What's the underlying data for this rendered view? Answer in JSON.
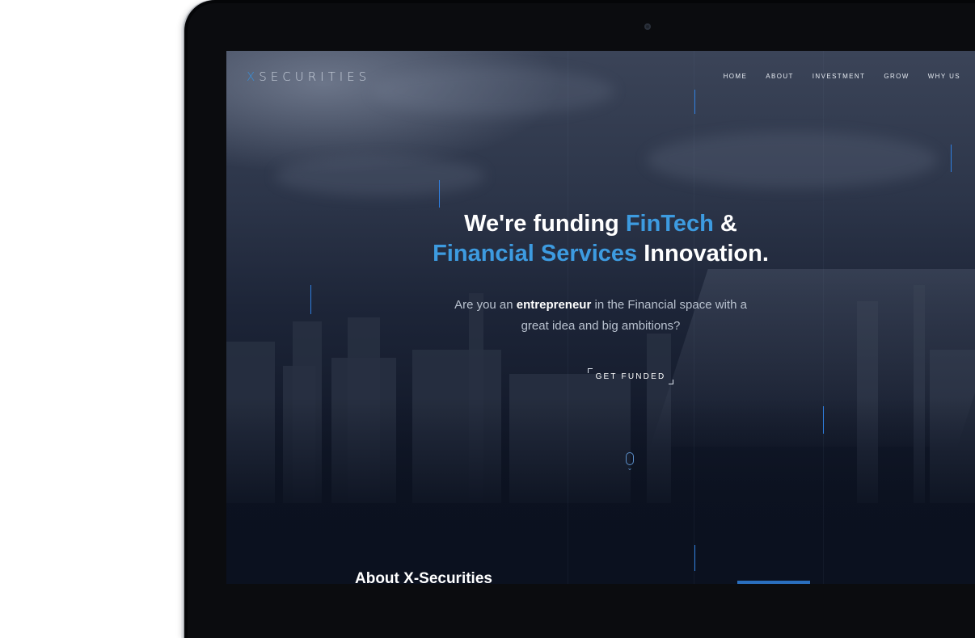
{
  "brand": {
    "logo_prefix": "X",
    "logo_rest": "SECURITIES",
    "accent_color": "#3d9be0"
  },
  "nav": {
    "items": [
      {
        "label": "HOME"
      },
      {
        "label": "ABOUT"
      },
      {
        "label": "INVESTMENT"
      },
      {
        "label": "GROW"
      },
      {
        "label": "WHY US"
      }
    ]
  },
  "hero": {
    "line1_plain": "We're funding ",
    "line1_highlight": "FinTech",
    "line1_end": " &",
    "line2_highlight": "Financial Services",
    "line2_end": " Innovation.",
    "sub_before": "Are you an ",
    "sub_bold": "entrepreneur",
    "sub_after": " in the Financial space with a",
    "sub_line2": "great idea and big ambitions?",
    "cta_label": "GET FUNDED"
  },
  "scroll_indicator": {
    "icon": "mouse-scroll-icon",
    "chevron": "chevron-down-icon"
  },
  "about": {
    "heading": "About X-Securities"
  }
}
